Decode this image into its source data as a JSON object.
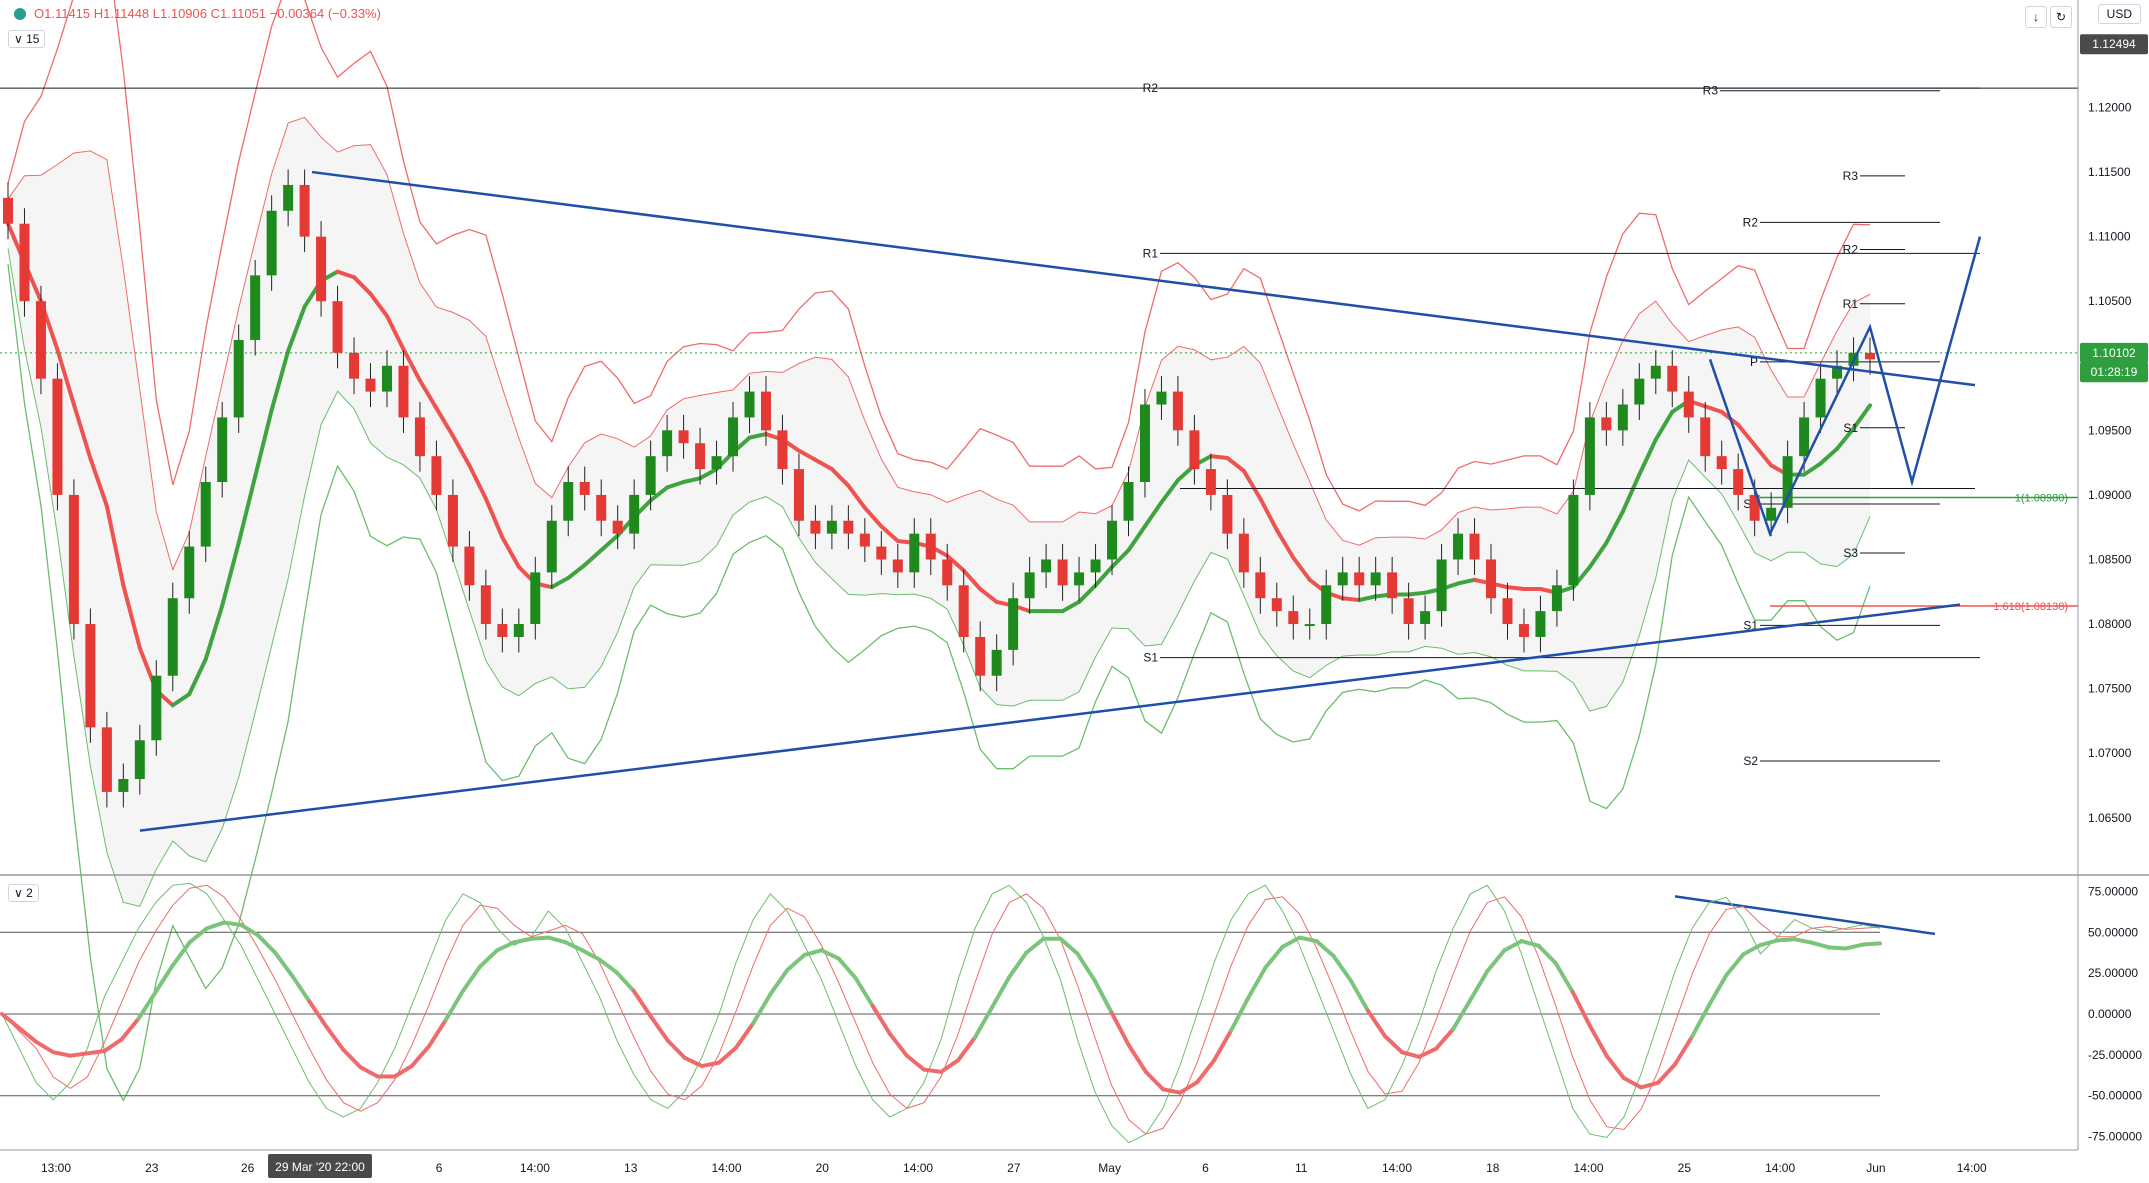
{
  "header": {
    "ohlc": "O1.11415 H1.11448 L1.10906 C1.11051 −0.00364 (−0.33%)",
    "main_pane_tag": "15",
    "osc_pane_tag": "2",
    "currency": "USD",
    "download_icon": "arrow-down-icon",
    "refresh_icon": "refresh-icon"
  },
  "chart_data": [
    {
      "type": "candlestick",
      "ylim": [
        1.0608,
        1.126
      ],
      "y_ticks": [
        "1.12000",
        "1.11500",
        "1.11000",
        "1.10500",
        "1.10000",
        "1.09500",
        "1.09000",
        "1.08500",
        "1.08000",
        "1.07500",
        "1.07000",
        "1.06500"
      ],
      "x_ticks": [
        "13:00",
        "23",
        "26",
        "Apr",
        "6",
        "14:00",
        "13",
        "14:00",
        "20",
        "14:00",
        "27",
        "May",
        "6",
        "11",
        "14:00",
        "18",
        "14:00",
        "25",
        "14:00",
        "Jun",
        "14:00"
      ],
      "x_highlight": "29 Mar '20  22:00",
      "price_tags": [
        {
          "label": "1.12494",
          "color": "#4a4a4a"
        },
        {
          "label": "1.10102",
          "color": "#2e9e3e"
        },
        {
          "label": "01:28:19",
          "color": "#2e9e3e"
        }
      ],
      "levels": [
        {
          "label": "R2",
          "price": 1.1215
        },
        {
          "label": "R1",
          "price": 1.1087
        },
        {
          "label": "S1",
          "price": 1.0774
        },
        {
          "label": "R3",
          "price": 1.1213
        },
        {
          "label": "R3",
          "price": 1.1147
        },
        {
          "label": "R2",
          "price": 1.1111
        },
        {
          "label": "R2",
          "price": 1.109
        },
        {
          "label": "R1",
          "price": 1.1048
        },
        {
          "label": "P",
          "price": 1.1003
        },
        {
          "label": "S1",
          "price": 1.0952
        },
        {
          "label": "S2",
          "price": 1.0893
        },
        {
          "label": "S3",
          "price": 1.0855
        },
        {
          "label": "S1",
          "price": 1.0799
        },
        {
          "label": "S2",
          "price": 1.0694
        }
      ],
      "fib_labels": [
        "1(1.08980)",
        "1.618(1.08138)"
      ],
      "close": [
        1.111,
        1.105,
        1.099,
        1.09,
        1.08,
        1.072,
        1.067,
        1.068,
        1.071,
        1.076,
        1.082,
        1.086,
        1.091,
        1.096,
        1.102,
        1.107,
        1.112,
        1.114,
        1.11,
        1.105,
        1.101,
        1.099,
        1.098,
        1.1,
        1.096,
        1.093,
        1.09,
        1.086,
        1.083,
        1.08,
        1.079,
        1.08,
        1.084,
        1.088,
        1.091,
        1.09,
        1.088,
        1.087,
        1.09,
        1.093,
        1.095,
        1.094,
        1.092,
        1.093,
        1.096,
        1.098,
        1.095,
        1.092,
        1.088,
        1.087,
        1.088,
        1.087,
        1.086,
        1.085,
        1.084,
        1.087,
        1.085,
        1.083,
        1.079,
        1.076,
        1.078,
        1.082,
        1.084,
        1.085,
        1.083,
        1.084,
        1.085,
        1.088,
        1.091,
        1.097,
        1.098,
        1.095,
        1.092,
        1.09,
        1.087,
        1.084,
        1.082,
        1.081,
        1.08,
        1.08,
        1.083,
        1.084,
        1.083,
        1.084,
        1.082,
        1.08,
        1.081,
        1.085,
        1.087,
        1.085,
        1.082,
        1.08,
        1.079,
        1.081,
        1.083,
        1.09,
        1.096,
        1.095,
        1.097,
        1.099,
        1.1,
        1.098,
        1.096,
        1.093,
        1.092,
        1.09,
        1.088,
        1.089,
        1.093,
        1.096,
        1.099,
        1.1,
        1.101,
        1.1005
      ]
    },
    {
      "type": "line",
      "name": "stochastic",
      "ylim": [
        -82,
        82
      ],
      "y_ticks": [
        "75.00000",
        "50.00000",
        "25.00000",
        "0.00000",
        "-25.00000",
        "-50.00000",
        "-75.00000"
      ],
      "levels": [
        50,
        0,
        -50
      ],
      "k": [
        0,
        -20,
        -40,
        -50,
        -40,
        -20,
        10,
        30,
        50,
        65,
        75,
        80,
        70,
        55,
        40,
        20,
        0,
        -20,
        -40,
        -55,
        -60,
        -55,
        -40,
        -20,
        5,
        30,
        55,
        70,
        65,
        50,
        40,
        45,
        60,
        50,
        30,
        10,
        -15,
        -35,
        -50,
        -55,
        -45,
        -25,
        0,
        30,
        55,
        70,
        60,
        40,
        20,
        -5,
        -30,
        -50,
        -60,
        -55,
        -40,
        -15,
        20,
        50,
        70,
        75,
        65,
        45,
        20,
        -15,
        -45,
        -65,
        -75,
        -70,
        -55,
        -30,
        0,
        30,
        55,
        70,
        75,
        60,
        40,
        15,
        -10,
        -35,
        -55,
        -50,
        -30,
        -5,
        25,
        50,
        70,
        75,
        60,
        35,
        5,
        -25,
        -55,
        -70,
        -72,
        -60,
        -35,
        -5,
        25,
        50,
        65,
        68,
        55,
        35,
        45,
        55,
        50,
        48,
        50,
        52,
        50
      ]
    }
  ]
}
